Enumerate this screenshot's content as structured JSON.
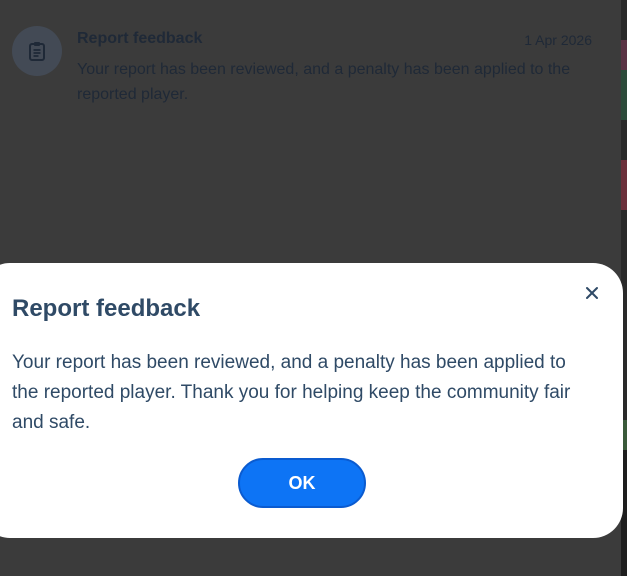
{
  "notification": {
    "icon": "clipboard-icon",
    "title": "Report feedback",
    "date": "1 Apr 2026",
    "body": "Your report has been reviewed, and a penalty has been applied to the reported player."
  },
  "dialog": {
    "title": "Report feedback",
    "body": "Your report has been reviewed, and a penalty has been applied to the reported player. Thank you for helping keep the community fair and safe.",
    "ok_label": "OK",
    "close_icon": "close-icon"
  },
  "colors": {
    "overlay": "#3b3b3b",
    "dialog_background": "#ffffff",
    "dialog_text": "#2f4a66",
    "primary_button": "#0d74f5"
  }
}
